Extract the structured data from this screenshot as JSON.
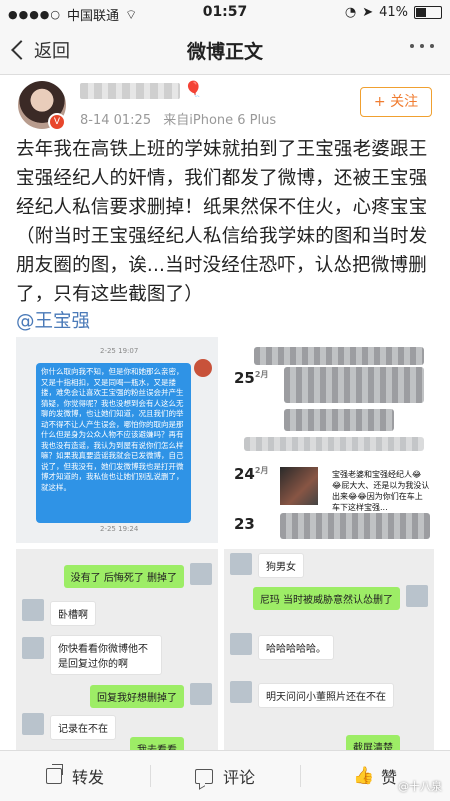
{
  "status_bar": {
    "carrier": "中国联通",
    "time": "01:57",
    "battery": "41%",
    "battery_level": 0.41
  },
  "navbar": {
    "back_label": "返回",
    "title": "微博正文"
  },
  "post": {
    "meta_time": "8-14 01:25",
    "meta_source": "来自iPhone 6 Plus",
    "follow_label": "+ 关注",
    "text": "去年我在高铁上班的学妹就拍到了王宝强老婆跟王宝强经纪人的奸情，我们都发了微博，还被王宝强经纪人私信要求删掉！纸果然保不住火，心疼宝宝 （附当时王宝强经纪人私信给我学妹的图和当时发朋友圈的图，诶...当时没经住恐吓，认怂把微博删了，只有这些截图了）",
    "mention": "@王宝强"
  },
  "images": {
    "pm": {
      "time_top": "2-25 19:07",
      "time_bottom": "2-25 19:24",
      "message": "你什么取向我不知，但是你和她那么亲密，又是十指相扣，又是同喝一瓶水，又是搂搂，难免会让喜欢王宝强的粉丝误会并产生猜疑，你觉得呢？我也没想到会有人这么无聊的发微博，也让她们知道，况且我们的举动不得不让人产生误会，哪怕你的取向是那什么但是身为公众人物不应该避嫌吗？再有我也没有造谣，我认为到屋有说你们怎么样嘛？如果我真要造谣我就会已发微博，自己说了，但我没有，她们发微博我也是打开微博才知道的，我私信也让她们别乱说删了，就这样。"
    },
    "moments": {
      "row1_day": "25",
      "row1_month": "2月",
      "row2_day": "24",
      "row2_month": "2月",
      "row2_text": "宝强老婆和宝强经纪人😂😂屁大大、还是以为我没认出来😂😂因为你们在车上车下这样宝强...",
      "row3_day": "23"
    },
    "chat1": {
      "msg1": "没有了 后悔死了 删掉了",
      "msg2": "卧槽啊",
      "msg3": "你快看看你微博他不是回复过你的啊",
      "msg4": "回复我好想删掉了",
      "msg5": "记录在不在",
      "msg6": "我去看看"
    },
    "chat2": {
      "msg1": "狗男女",
      "msg2": "尼玛 当时被威胁意然认怂删了",
      "msg3": "哈哈哈哈哈。",
      "msg4": "明天问问小董照片还在不在",
      "msg5": "截屏清楚"
    }
  },
  "actions": {
    "repost": "转发",
    "comment": "评论",
    "like": "赞"
  },
  "watermark": "@十八泉"
}
